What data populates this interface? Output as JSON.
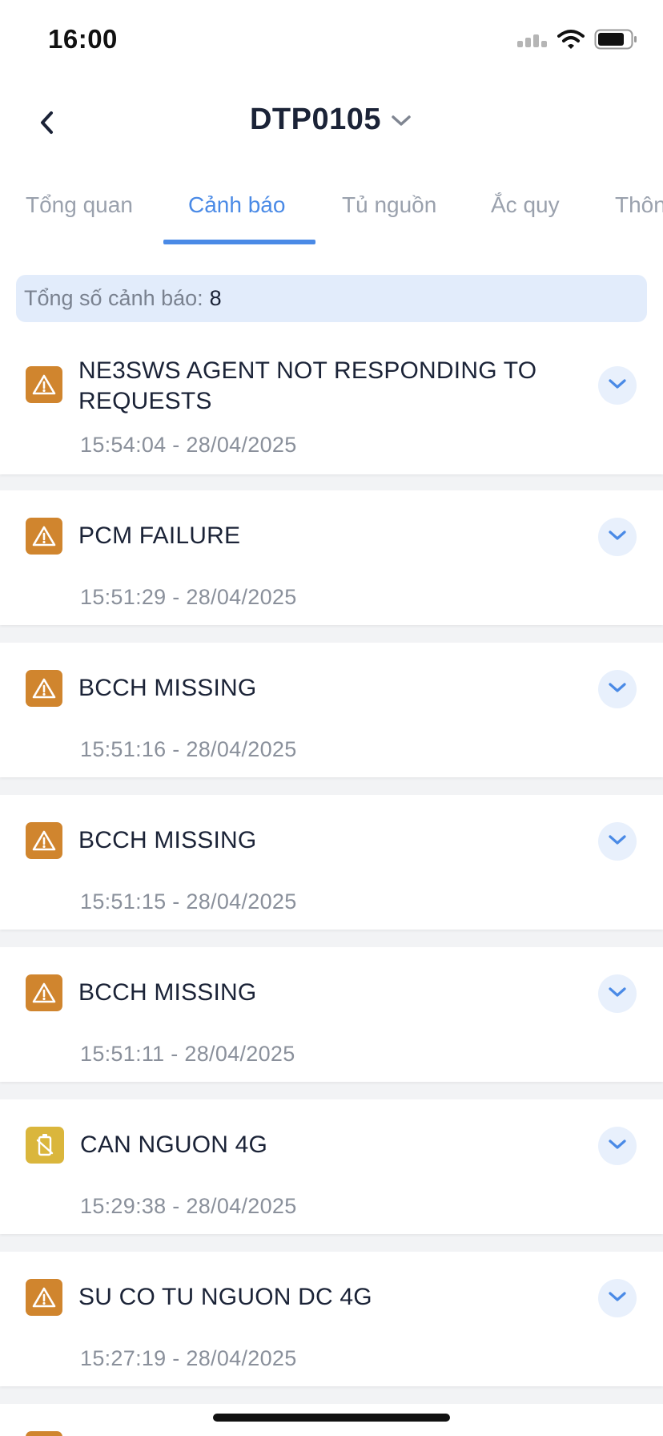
{
  "status_bar": {
    "time": "16:00"
  },
  "header": {
    "title": "DTP0105"
  },
  "tabs": [
    {
      "label": "Tổng quan"
    },
    {
      "label": "Cảnh báo"
    },
    {
      "label": "Tủ nguồn"
    },
    {
      "label": "Ắc quy"
    },
    {
      "label": "Thôn"
    }
  ],
  "summary": {
    "label": "Tổng số cảnh báo:",
    "count": "8"
  },
  "alerts": [
    {
      "title": "NE3SWS AGENT NOT RESPONDING TO REQUESTS",
      "time": "15:54:04 - 28/04/2025",
      "icon": "warning-icon"
    },
    {
      "title": "PCM FAILURE",
      "time": "15:51:29 - 28/04/2025",
      "icon": "warning-icon"
    },
    {
      "title": "BCCH MISSING",
      "time": "15:51:16 - 28/04/2025",
      "icon": "warning-icon"
    },
    {
      "title": "BCCH MISSING",
      "time": "15:51:15 - 28/04/2025",
      "icon": "warning-icon"
    },
    {
      "title": "BCCH MISSING",
      "time": "15:51:11 - 28/04/2025",
      "icon": "warning-icon"
    },
    {
      "title": "CAN NGUON 4G",
      "time": "15:29:38 - 28/04/2025",
      "icon": "battery-empty-icon"
    },
    {
      "title": "SU CO TU NGUON DC 4G",
      "time": "15:27:19 - 28/04/2025",
      "icon": "warning-icon"
    }
  ],
  "colors": {
    "accent": "#4a8ae6",
    "warning": "#d0852e",
    "battery": "#dab63c",
    "summary_bg": "#e2ecfb"
  }
}
